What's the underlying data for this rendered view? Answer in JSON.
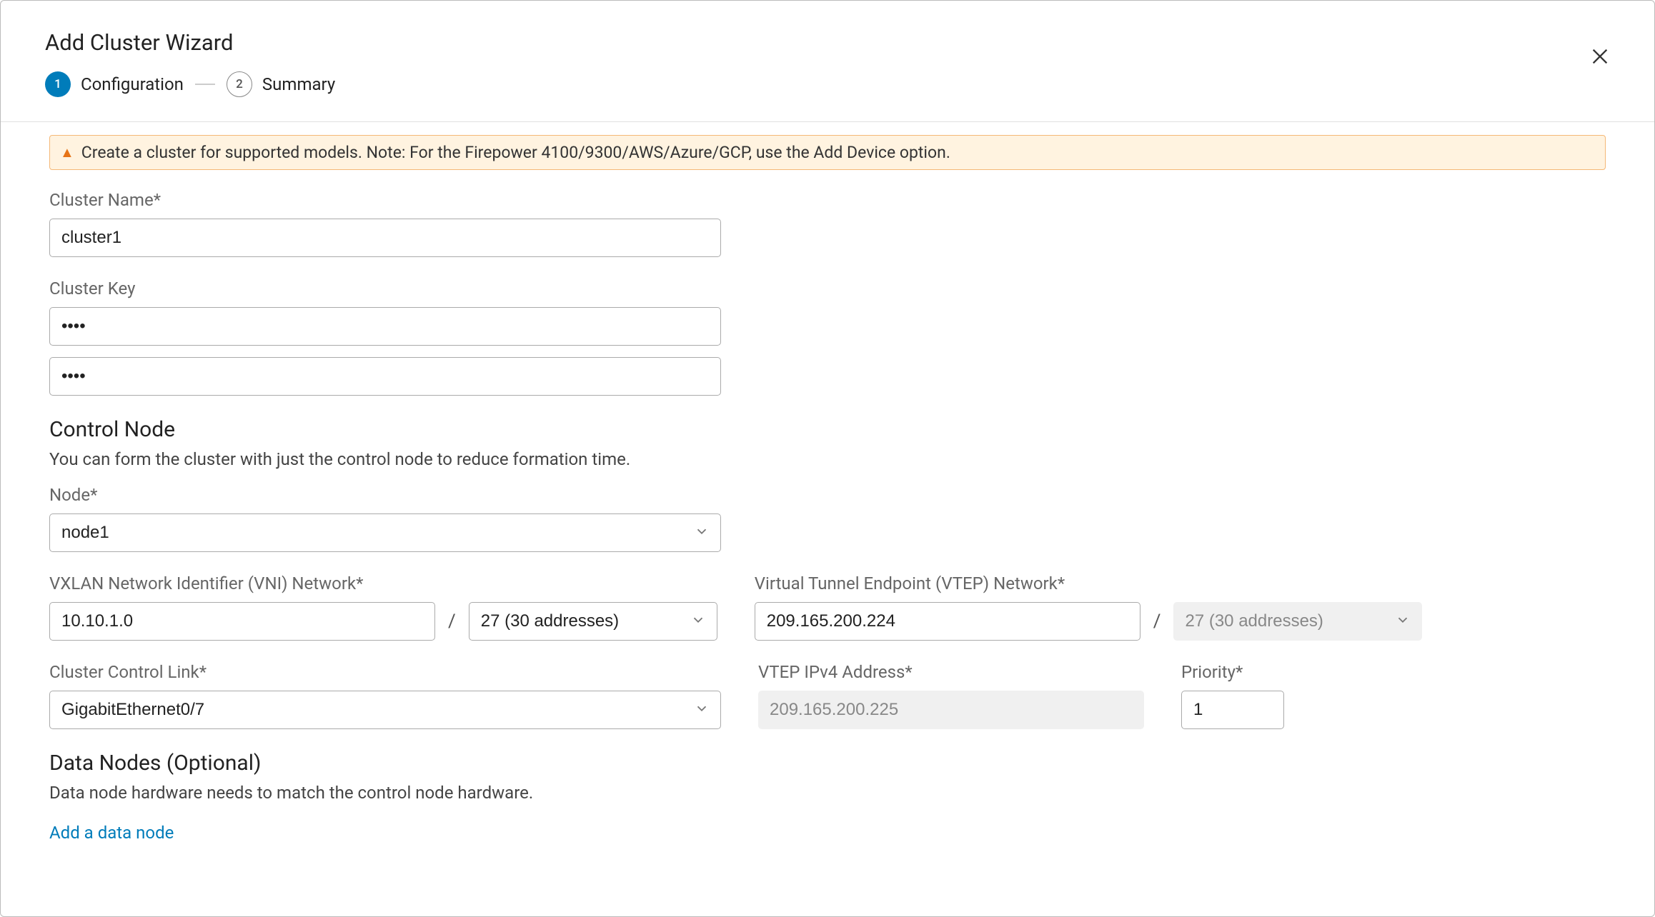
{
  "header": {
    "title": "Add Cluster Wizard",
    "steps": [
      {
        "num": "1",
        "label": "Configuration"
      },
      {
        "num": "2",
        "label": "Summary"
      }
    ]
  },
  "alert": {
    "text": "Create a cluster for supported models. Note: For the Firepower 4100/9300/AWS/Azure/GCP, use the Add Device option."
  },
  "fields": {
    "cluster_name_label": "Cluster Name*",
    "cluster_name_value": "cluster1",
    "cluster_key_label": "Cluster Key",
    "cluster_key_value1": "••••",
    "cluster_key_value2": "••••"
  },
  "control_node": {
    "heading": "Control Node",
    "sub": "You can form the cluster with just the control node to reduce formation time.",
    "node_label": "Node*",
    "node_value": "node1",
    "vni_label": "VXLAN Network Identifier (VNI) Network*",
    "vni_ip": "10.10.1.0",
    "vni_cidr": "27 (30 addresses)",
    "vtep_label": "Virtual Tunnel Endpoint (VTEP) Network*",
    "vtep_ip": "209.165.200.224",
    "vtep_cidr": "27 (30 addresses)",
    "ccl_label": "Cluster Control Link*",
    "ccl_value": "GigabitEthernet0/7",
    "vtep_addr_label": "VTEP IPv4 Address*",
    "vtep_addr_value": "209.165.200.225",
    "priority_label": "Priority*",
    "priority_value": "1"
  },
  "data_nodes": {
    "heading": "Data Nodes (Optional)",
    "sub": "Data node hardware needs to match the control node hardware.",
    "add_link": "Add a data node"
  }
}
